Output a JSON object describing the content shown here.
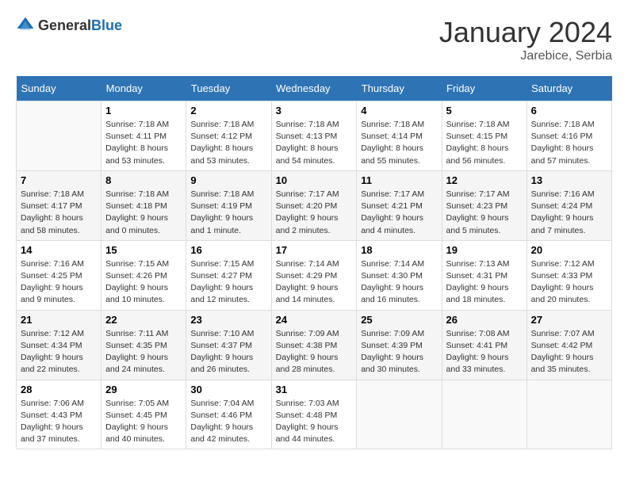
{
  "header": {
    "logo": {
      "general": "General",
      "blue": "Blue"
    },
    "month": "January 2024",
    "location": "Jarebice, Serbia"
  },
  "weekdays": [
    "Sunday",
    "Monday",
    "Tuesday",
    "Wednesday",
    "Thursday",
    "Friday",
    "Saturday"
  ],
  "weeks": [
    [
      {
        "day": "",
        "info": ""
      },
      {
        "day": "1",
        "info": "Sunrise: 7:18 AM\nSunset: 4:11 PM\nDaylight: 8 hours\nand 53 minutes."
      },
      {
        "day": "2",
        "info": "Sunrise: 7:18 AM\nSunset: 4:12 PM\nDaylight: 8 hours\nand 53 minutes."
      },
      {
        "day": "3",
        "info": "Sunrise: 7:18 AM\nSunset: 4:13 PM\nDaylight: 8 hours\nand 54 minutes."
      },
      {
        "day": "4",
        "info": "Sunrise: 7:18 AM\nSunset: 4:14 PM\nDaylight: 8 hours\nand 55 minutes."
      },
      {
        "day": "5",
        "info": "Sunrise: 7:18 AM\nSunset: 4:15 PM\nDaylight: 8 hours\nand 56 minutes."
      },
      {
        "day": "6",
        "info": "Sunrise: 7:18 AM\nSunset: 4:16 PM\nDaylight: 8 hours\nand 57 minutes."
      }
    ],
    [
      {
        "day": "7",
        "info": "Sunrise: 7:18 AM\nSunset: 4:17 PM\nDaylight: 8 hours\nand 58 minutes."
      },
      {
        "day": "8",
        "info": "Sunrise: 7:18 AM\nSunset: 4:18 PM\nDaylight: 9 hours\nand 0 minutes."
      },
      {
        "day": "9",
        "info": "Sunrise: 7:18 AM\nSunset: 4:19 PM\nDaylight: 9 hours\nand 1 minute."
      },
      {
        "day": "10",
        "info": "Sunrise: 7:17 AM\nSunset: 4:20 PM\nDaylight: 9 hours\nand 2 minutes."
      },
      {
        "day": "11",
        "info": "Sunrise: 7:17 AM\nSunset: 4:21 PM\nDaylight: 9 hours\nand 4 minutes."
      },
      {
        "day": "12",
        "info": "Sunrise: 7:17 AM\nSunset: 4:23 PM\nDaylight: 9 hours\nand 5 minutes."
      },
      {
        "day": "13",
        "info": "Sunrise: 7:16 AM\nSunset: 4:24 PM\nDaylight: 9 hours\nand 7 minutes."
      }
    ],
    [
      {
        "day": "14",
        "info": "Sunrise: 7:16 AM\nSunset: 4:25 PM\nDaylight: 9 hours\nand 9 minutes."
      },
      {
        "day": "15",
        "info": "Sunrise: 7:15 AM\nSunset: 4:26 PM\nDaylight: 9 hours\nand 10 minutes."
      },
      {
        "day": "16",
        "info": "Sunrise: 7:15 AM\nSunset: 4:27 PM\nDaylight: 9 hours\nand 12 minutes."
      },
      {
        "day": "17",
        "info": "Sunrise: 7:14 AM\nSunset: 4:29 PM\nDaylight: 9 hours\nand 14 minutes."
      },
      {
        "day": "18",
        "info": "Sunrise: 7:14 AM\nSunset: 4:30 PM\nDaylight: 9 hours\nand 16 minutes."
      },
      {
        "day": "19",
        "info": "Sunrise: 7:13 AM\nSunset: 4:31 PM\nDaylight: 9 hours\nand 18 minutes."
      },
      {
        "day": "20",
        "info": "Sunrise: 7:12 AM\nSunset: 4:33 PM\nDaylight: 9 hours\nand 20 minutes."
      }
    ],
    [
      {
        "day": "21",
        "info": "Sunrise: 7:12 AM\nSunset: 4:34 PM\nDaylight: 9 hours\nand 22 minutes."
      },
      {
        "day": "22",
        "info": "Sunrise: 7:11 AM\nSunset: 4:35 PM\nDaylight: 9 hours\nand 24 minutes."
      },
      {
        "day": "23",
        "info": "Sunrise: 7:10 AM\nSunset: 4:37 PM\nDaylight: 9 hours\nand 26 minutes."
      },
      {
        "day": "24",
        "info": "Sunrise: 7:09 AM\nSunset: 4:38 PM\nDaylight: 9 hours\nand 28 minutes."
      },
      {
        "day": "25",
        "info": "Sunrise: 7:09 AM\nSunset: 4:39 PM\nDaylight: 9 hours\nand 30 minutes."
      },
      {
        "day": "26",
        "info": "Sunrise: 7:08 AM\nSunset: 4:41 PM\nDaylight: 9 hours\nand 33 minutes."
      },
      {
        "day": "27",
        "info": "Sunrise: 7:07 AM\nSunset: 4:42 PM\nDaylight: 9 hours\nand 35 minutes."
      }
    ],
    [
      {
        "day": "28",
        "info": "Sunrise: 7:06 AM\nSunset: 4:43 PM\nDaylight: 9 hours\nand 37 minutes."
      },
      {
        "day": "29",
        "info": "Sunrise: 7:05 AM\nSunset: 4:45 PM\nDaylight: 9 hours\nand 40 minutes."
      },
      {
        "day": "30",
        "info": "Sunrise: 7:04 AM\nSunset: 4:46 PM\nDaylight: 9 hours\nand 42 minutes."
      },
      {
        "day": "31",
        "info": "Sunrise: 7:03 AM\nSunset: 4:48 PM\nDaylight: 9 hours\nand 44 minutes."
      },
      {
        "day": "",
        "info": ""
      },
      {
        "day": "",
        "info": ""
      },
      {
        "day": "",
        "info": ""
      }
    ]
  ]
}
